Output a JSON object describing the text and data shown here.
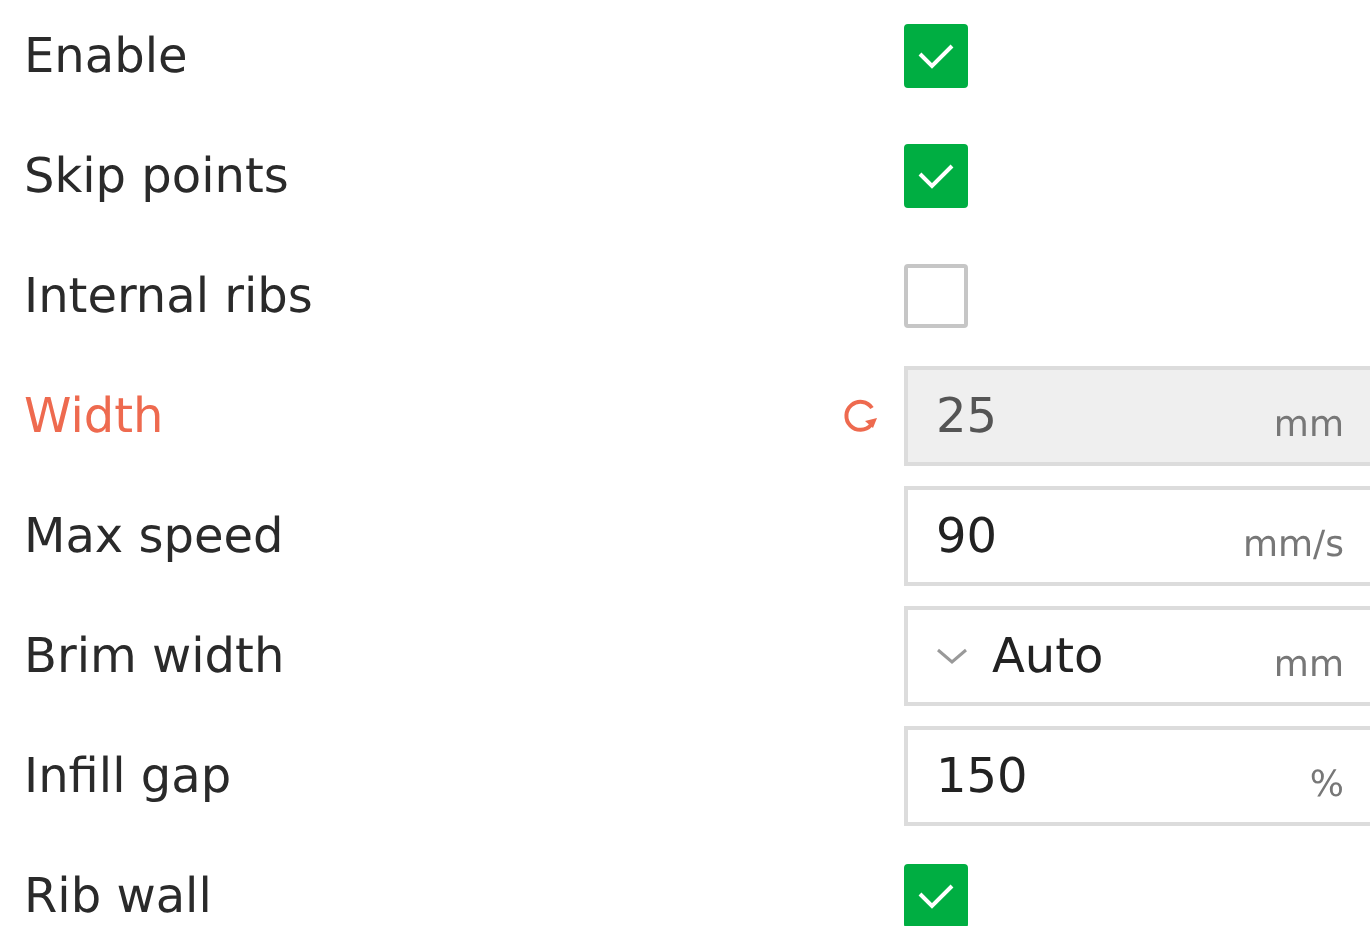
{
  "settings": [
    {
      "kind": "checkbox",
      "label": "Enable",
      "checked": true
    },
    {
      "kind": "checkbox",
      "label": "Skip points",
      "checked": true
    },
    {
      "kind": "checkbox",
      "label": "Internal ribs",
      "checked": false
    },
    {
      "kind": "field",
      "label": "Width",
      "value": "25",
      "unit": "mm",
      "modified": true,
      "disabled": true
    },
    {
      "kind": "field",
      "label": "Max speed",
      "value": "90",
      "unit": "mm/s",
      "modified": false,
      "disabled": false
    },
    {
      "kind": "dropdown",
      "label": "Brim width",
      "value": "Auto",
      "unit": "mm",
      "modified": false,
      "disabled": false
    },
    {
      "kind": "field",
      "label": "Infill gap",
      "value": "150",
      "unit": "%",
      "modified": false,
      "disabled": false
    },
    {
      "kind": "checkbox",
      "label": "Rib wall",
      "checked": true
    }
  ]
}
